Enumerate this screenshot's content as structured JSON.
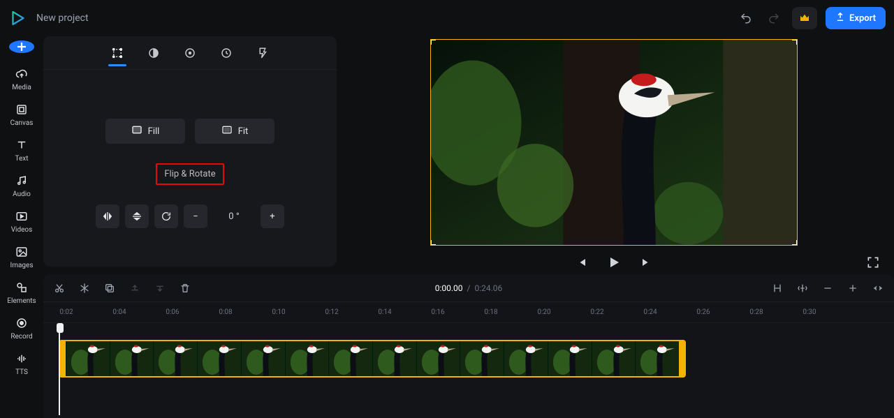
{
  "header": {
    "project_title": "New project",
    "export_label": "Export"
  },
  "sidebar": {
    "items": [
      {
        "label": "Media"
      },
      {
        "label": "Canvas"
      },
      {
        "label": "Text"
      },
      {
        "label": "Audio"
      },
      {
        "label": "Videos"
      },
      {
        "label": "Images"
      },
      {
        "label": "Elements"
      },
      {
        "label": "Record"
      },
      {
        "label": "TTS"
      }
    ]
  },
  "properties": {
    "fill_label": "Fill",
    "fit_label": "Fit",
    "flip_rotate_label": "Flip & Rotate",
    "rotate_minus": "−",
    "rotate_plus": "+",
    "rotate_value": "0 °"
  },
  "player": {
    "current_time": "0:00.00",
    "separator": "/",
    "duration": "0:24.06"
  },
  "ruler": {
    "ticks": [
      "0:02",
      "0:04",
      "0:06",
      "0:08",
      "0:10",
      "0:12",
      "0:14",
      "0:16",
      "0:18",
      "0:20",
      "0:22",
      "0:24",
      "0:26",
      "0:28",
      "0:30"
    ]
  }
}
